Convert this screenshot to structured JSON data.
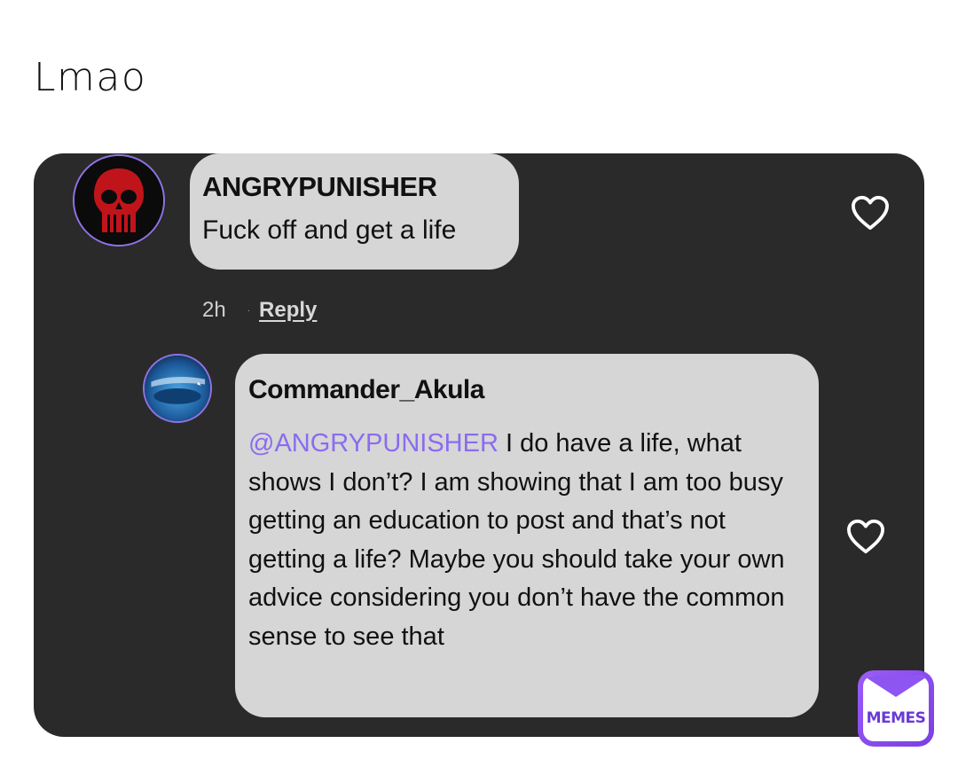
{
  "caption": "Lmao",
  "comment": {
    "username": "ANGRYPUNISHER",
    "text": "Fuck off and get a life",
    "time": "2h",
    "reply_label": "Reply",
    "like_icon": "heart-outline-icon",
    "avatar_icon": "punisher-skull-icon"
  },
  "reply": {
    "username": "Commander_Akula",
    "mention": "@ANGRYPUNISHER",
    "text": " I do have a life, what shows I don’t? I am showing that I am too busy getting an education to post and that’s not getting a life? Maybe you should take your own advice considering you don’t have the common sense to see that",
    "like_icon": "heart-outline-icon",
    "avatar_icon": "submarine-avatar-icon"
  },
  "watermark": {
    "label": "MEMES"
  },
  "colors": {
    "panel": "#2a2a2a",
    "bubble": "#d6d6d6",
    "mention": "#8a6cf0",
    "avatar_ring": "#8f72e6",
    "badge": "#8e55f2"
  }
}
